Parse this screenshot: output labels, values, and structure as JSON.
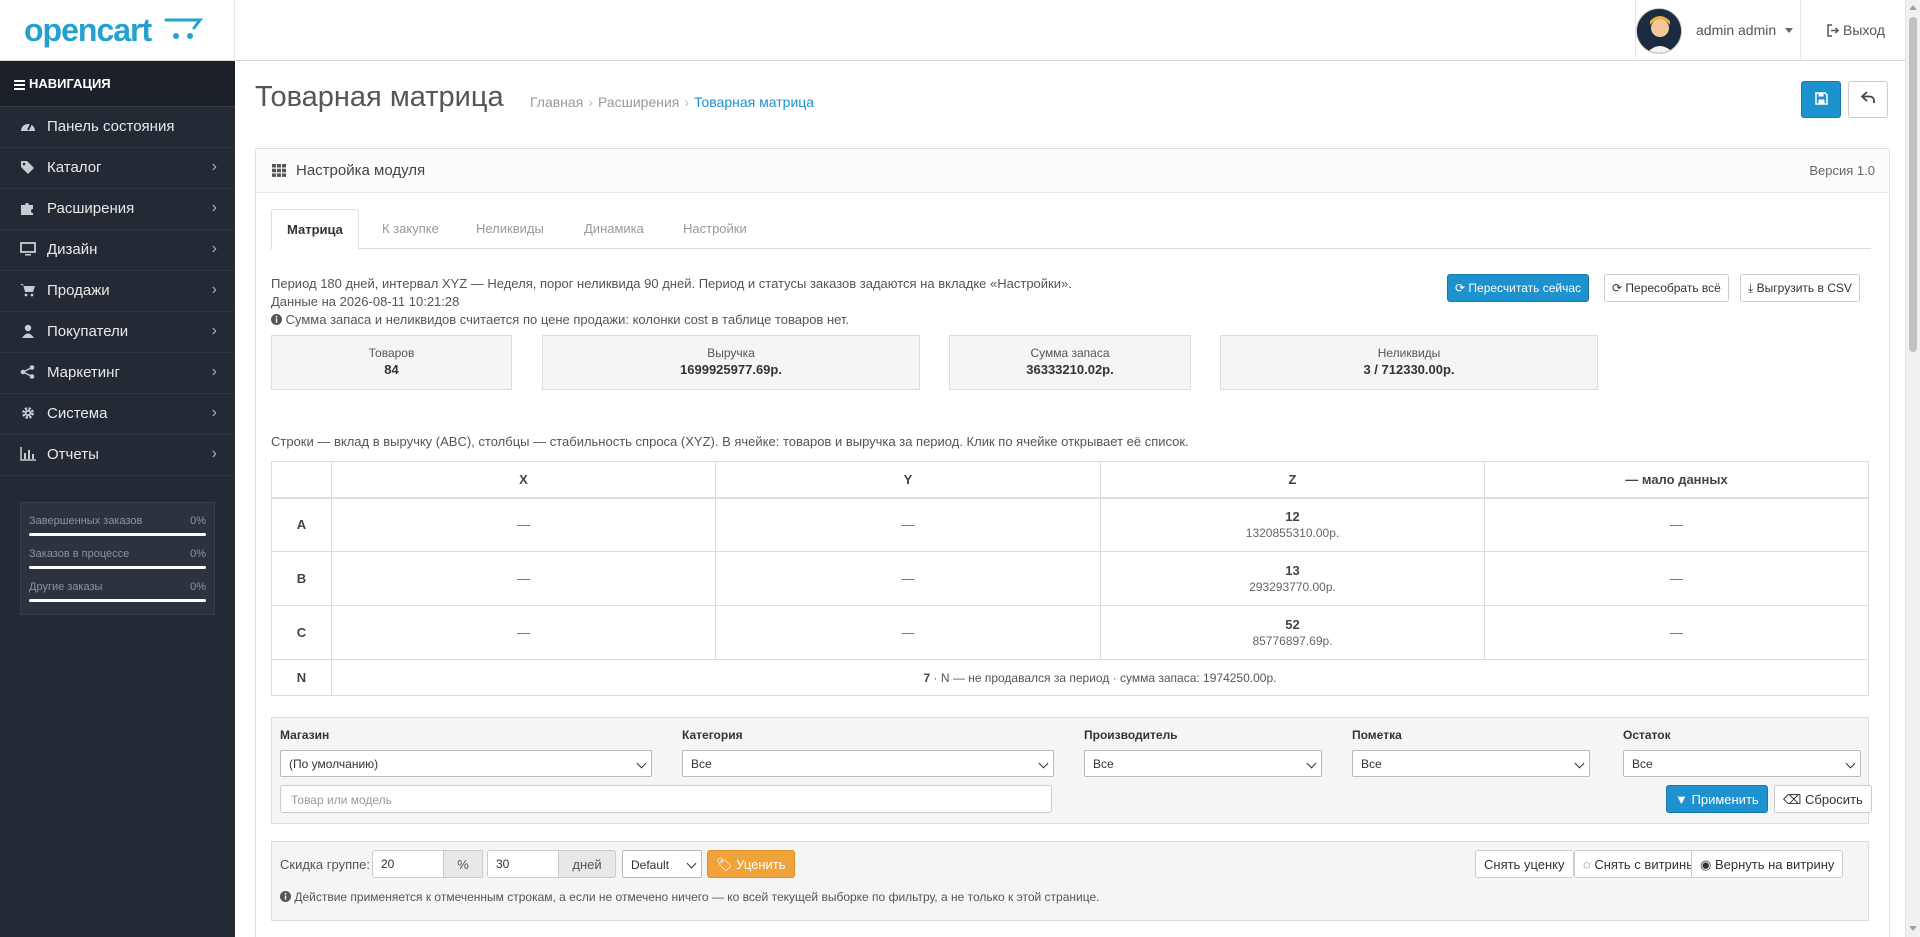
{
  "header": {
    "logo": "opencart",
    "user_name": "admin admin",
    "logout_label": "Выход"
  },
  "sidebar": {
    "heading": "НАВИГАЦИЯ",
    "items": [
      {
        "label": "Панель состояния",
        "icon": "dashboard-icon",
        "has_submenu": false
      },
      {
        "label": "Каталог",
        "icon": "tags-icon",
        "has_submenu": true
      },
      {
        "label": "Расширения",
        "icon": "puzzle-icon",
        "has_submenu": true
      },
      {
        "label": "Дизайн",
        "icon": "monitor-icon",
        "has_submenu": true
      },
      {
        "label": "Продажи",
        "icon": "cart-icon",
        "has_submenu": true
      },
      {
        "label": "Покупатели",
        "icon": "user-icon",
        "has_submenu": true
      },
      {
        "label": "Маркетинг",
        "icon": "share-icon",
        "has_submenu": true
      },
      {
        "label": "Система",
        "icon": "gear-icon",
        "has_submenu": true
      },
      {
        "label": "Отчеты",
        "icon": "bar-chart-icon",
        "has_submenu": true
      }
    ],
    "stats": [
      {
        "label": "Завершенных заказов",
        "value": "0%",
        "fraction": 0
      },
      {
        "label": "Заказов в процессе",
        "value": "0%",
        "fraction": 0
      },
      {
        "label": "Другие заказы",
        "value": "0%",
        "fraction": 0
      }
    ]
  },
  "page": {
    "title": "Товарная матрица",
    "breadcrumb": [
      "Главная",
      "Расширения",
      "Товарная матрица"
    ]
  },
  "panel": {
    "title": "Настройка модуля",
    "version": "Версия 1.0",
    "tabs": [
      "Матрица",
      "К закупке",
      "Неликвиды",
      "Динамика",
      "Настройки"
    ],
    "active_tab": 0
  },
  "info": {
    "line1": "Период 180 дней, интервал XYZ — Неделя, порог неликвида 90 дней. Период и статусы заказов задаются на вкладке «Настройки».",
    "line2": "Данные на 2026-08-11 10:21:28",
    "line3": "Сумма запаса и неликвидов считается по цене продажи: колонки cost в таблице товаров нет."
  },
  "actions": {
    "recalc": "Пересчитать сейчас",
    "rebuild": "Пересобрать всё",
    "export": "Выгрузить в CSV"
  },
  "kpis": [
    {
      "label": "Товаров",
      "value": "84"
    },
    {
      "label": "Выручка",
      "value": "1699925977.69р."
    },
    {
      "label": "Сумма запаса",
      "value": "36333210.02р."
    },
    {
      "label": "Неликвиды",
      "value": "3 / 712330.00р."
    }
  ],
  "matrix": {
    "hint": "Строки — вклад в выручку (ABC), столбцы — стабильность спроса (XYZ). В ячейке: товаров и выручка за период. Клик по ячейке открывает её список.",
    "columns": [
      "X",
      "Y",
      "Z",
      "— мало данных"
    ],
    "rows": [
      {
        "label": "A",
        "cells": [
          "—",
          "—",
          {
            "count": "12",
            "sum": "1320855310.00р."
          },
          "—"
        ]
      },
      {
        "label": "B",
        "cells": [
          "—",
          "—",
          {
            "count": "13",
            "sum": "293293770.00р."
          },
          "—"
        ]
      },
      {
        "label": "C",
        "cells": [
          "—",
          "—",
          {
            "count": "52",
            "sum": "85776897.69р."
          },
          "—"
        ]
      }
    ],
    "n_row": {
      "label": "N",
      "count": "7",
      "text": " · N — не продавался за период · сумма запаса: 1974250.00р."
    }
  },
  "filter": {
    "store_label": "Магазин",
    "store_value": "(По умолчанию)",
    "category_label": "Категория",
    "category_value": "Все",
    "manufacturer_label": "Производитель",
    "manufacturer_value": "Все",
    "mark_label": "Пометка",
    "mark_value": "Все",
    "stock_label": "Остаток",
    "stock_value": "Все",
    "search_placeholder": "Товар или модель",
    "apply": "Применить",
    "reset": "Сбросить"
  },
  "discount": {
    "label": "Скидка группе:",
    "percent_value": "20",
    "percent_addon": "%",
    "days_value": "30",
    "days_addon": "дней",
    "group_select": "Default",
    "apply": "Уценить",
    "remove_discount": "Снять уценку",
    "hide": "Снять с витрины",
    "restore": "Вернуть на витрину",
    "note": "Действие применяется к отмеченным строкам, а если не отмечено ничего — ко всей текущей выборке по фильтру, а не только к этой странице."
  },
  "colors": {
    "primary": "#1e91cf",
    "warning": "#f0a33a",
    "sidebar_bg": "#242a34"
  }
}
